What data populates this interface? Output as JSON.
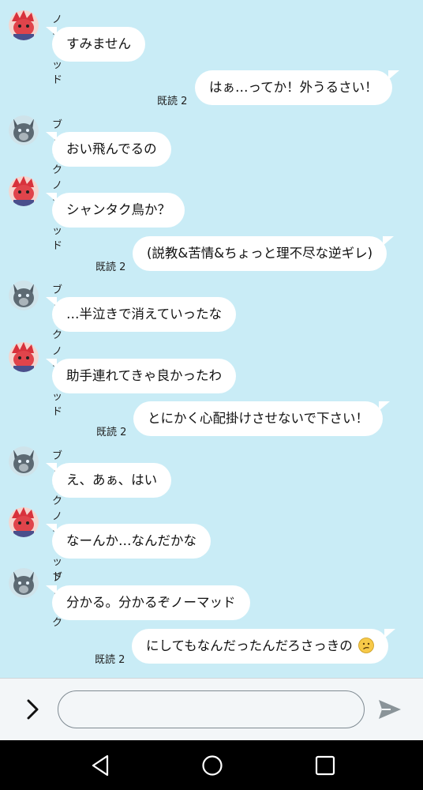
{
  "characters": {
    "nomad": {
      "name": "ノーマッド",
      "avatar_icon": "red-dragon-avatar-icon",
      "color": "#e0444b"
    },
    "break": {
      "name": "ブレイク",
      "avatar_icon": "gray-wolf-avatar-icon",
      "color": "#5d6a73"
    }
  },
  "messages": [
    {
      "type": "in",
      "sender": "ノーマッド",
      "text": "すみません"
    },
    {
      "type": "out",
      "text": "はぁ…ってか！外うるさい！",
      "read": "既読 2"
    },
    {
      "type": "in",
      "sender": "ブレイク",
      "text": "おい飛んでるの"
    },
    {
      "type": "in",
      "sender": "ノーマッド",
      "text": "シャンタク鳥か？"
    },
    {
      "type": "out",
      "text": "(説教&苦情&ちょっと理不尽な逆ギレ)",
      "read": "既読 2"
    },
    {
      "type": "in",
      "sender": "ブレイク",
      "text": "…半泣きで消えていったな"
    },
    {
      "type": "in",
      "sender": "ノーマッド",
      "text": "助手連れてきゃ良かったわ"
    },
    {
      "type": "out",
      "text": "とにかく心配掛けさせないで下さい！",
      "read": "既読 2"
    },
    {
      "type": "in",
      "sender": "ブレイク",
      "text": "え、あぁ、はい"
    },
    {
      "type": "in",
      "sender": "ノーマッド",
      "text": "なーんか…なんだかな"
    },
    {
      "type": "in",
      "sender": "ブレイク",
      "text": "分かる。分かるぞノーマッド"
    },
    {
      "type": "out",
      "text": "にしてもなんだったんだろさっきの",
      "emoji": "confused-face-icon",
      "read": "既読 2"
    }
  ],
  "input": {
    "value": "",
    "placeholder": ""
  },
  "icons": {
    "expand": "chevron-right-icon",
    "send": "send-icon",
    "nav_back": "back-triangle-icon",
    "nav_home": "home-circle-icon",
    "nav_recent": "recent-apps-square-icon"
  },
  "colors": {
    "background": "#c9ecf6",
    "bubble": "#ffffff",
    "nav_bar": "#000000",
    "input_bar": "#f3f6f8"
  }
}
